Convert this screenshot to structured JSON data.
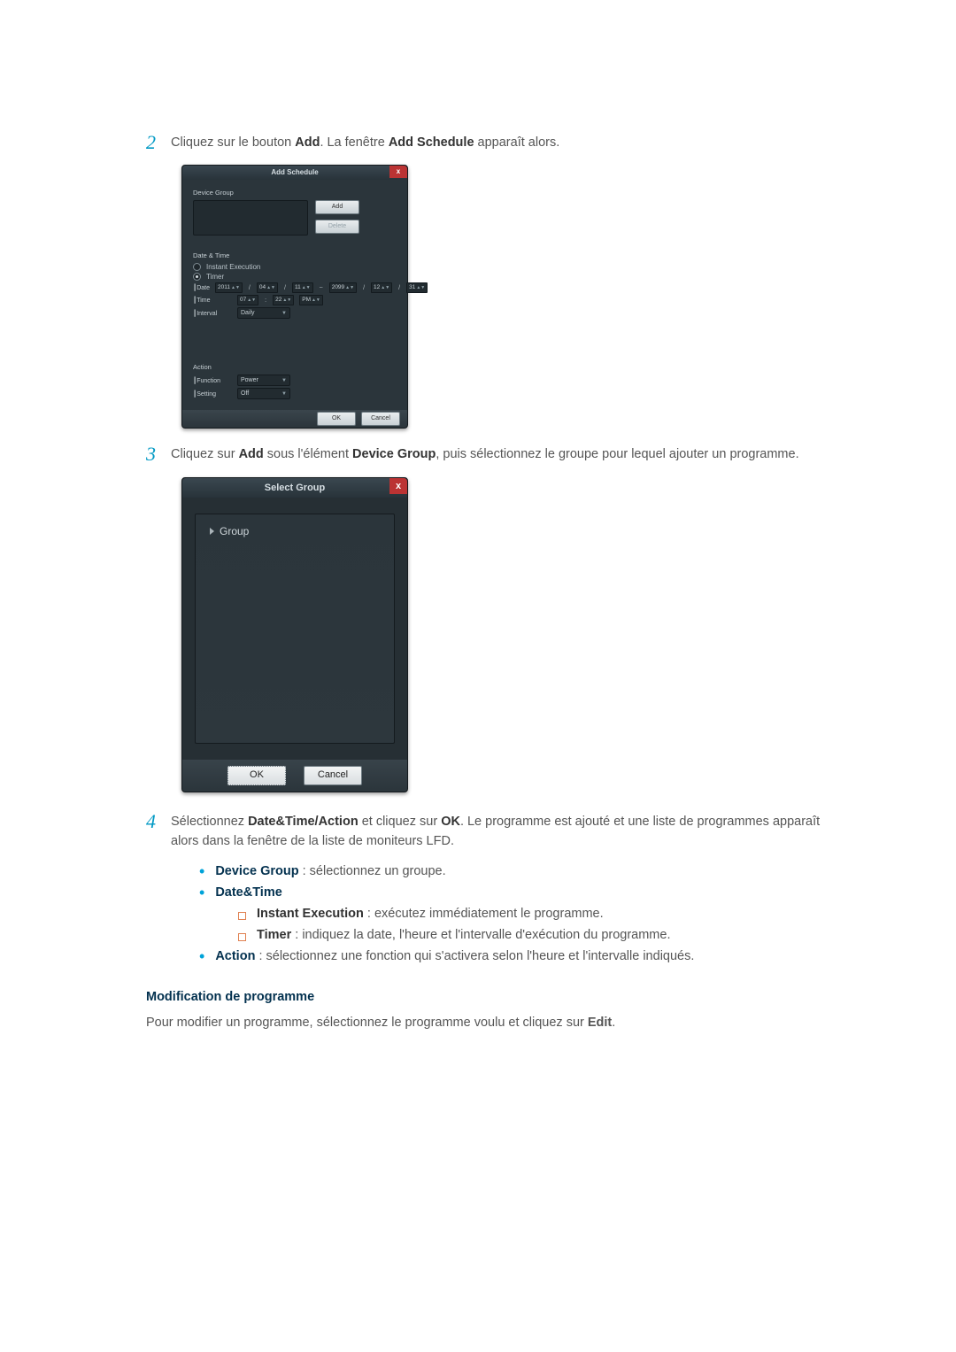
{
  "step2": {
    "num": "2",
    "pre": "Cliquez sur le bouton ",
    "b1": "Add",
    "mid": ". La fenêtre ",
    "b2": "Add Schedule",
    "post": " apparaît alors."
  },
  "addSchedule": {
    "title": "Add Schedule",
    "deviceGroupLabel": "Device Group",
    "addBtn": "Add",
    "deleteBtn": "Delete",
    "dateTimeLabel": "Date & Time",
    "instant": "Instant Execution",
    "timer": "Timer",
    "dateLabel": "┃Date",
    "date": {
      "y1": "2011",
      "m1": "04",
      "d1": "11",
      "dash": "~",
      "y2": "2099",
      "m2": "12",
      "d2": "31"
    },
    "timeLabel": "┃Time",
    "time": {
      "h": "07",
      "m": "22",
      "ap": "PM"
    },
    "intervalLabel": "┃Interval",
    "interval": "Daily",
    "actionLabel": "Action",
    "functionLabel": "┃Function",
    "functionVal": "Power",
    "settingLabel": "┃Setting",
    "settingVal": "Off",
    "ok": "OK",
    "cancel": "Cancel"
  },
  "step3": {
    "num": "3",
    "pre": "Cliquez sur ",
    "b1": "Add",
    "mid1": " sous l'élément ",
    "b2": "Device Group",
    "post": ", puis sélectionnez le groupe pour lequel ajouter un programme."
  },
  "selectGroup": {
    "title": "Select Group",
    "item": "Group",
    "ok": "OK",
    "cancel": "Cancel"
  },
  "step4": {
    "num": "4",
    "pre": "Sélectionnez ",
    "b1": "Date&Time/Action",
    "mid1": " et cliquez sur ",
    "b2": "OK",
    "post": ". Le programme est ajouté et une liste de programmes apparaît alors dans la fenêtre de la liste de moniteurs LFD."
  },
  "bullets": {
    "deviceGroup": {
      "label": "Device Group",
      "text": " : sélectionnez un groupe."
    },
    "dateTime": {
      "label": "Date&Time"
    },
    "instant": {
      "label": "Instant Execution",
      "text": " : exécutez immédiatement le programme."
    },
    "timer": {
      "label": "Timer",
      "text": " : indiquez la date, l'heure et l'intervalle d'exécution du programme."
    },
    "action": {
      "label": "Action",
      "text": " : sélectionnez une fonction qui s'activera selon l'heure et l'intervalle indiqués."
    }
  },
  "modif": {
    "title": "Modification de programme",
    "body_pre": "Pour modifier un programme, sélectionnez le programme voulu et cliquez sur ",
    "body_b": "Edit",
    "body_post": "."
  }
}
